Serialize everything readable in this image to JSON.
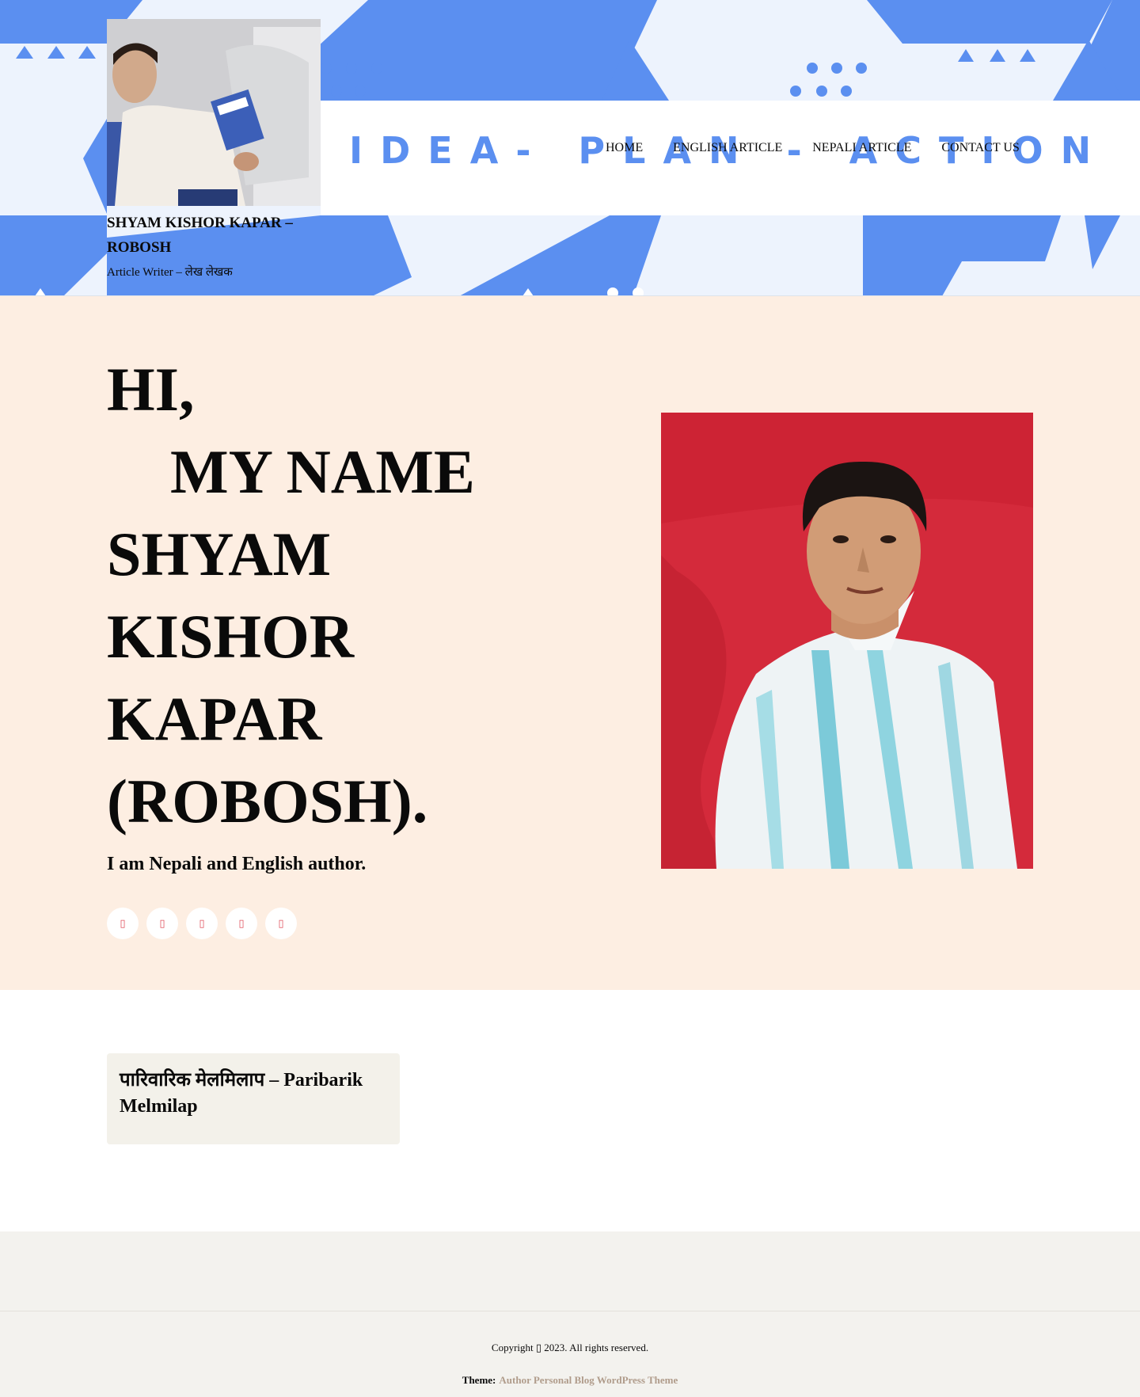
{
  "site": {
    "title": "SHYAM KISHOR KAPAR – ROBOSH",
    "tagline": "Article Writer – लेख लेखक"
  },
  "header": {
    "slogan": "IDEA- PLAN - ACTION"
  },
  "nav": {
    "items": [
      "HOME",
      "ENGLISH ARTICLE",
      "NEPALI ARTICLE",
      "CONTACT US"
    ]
  },
  "hero": {
    "heading_line1": "HI,",
    "heading_line2": "MY NAME",
    "heading_line3": "SHYAM",
    "heading_line4": "KISHOR",
    "heading_line5": "KAPAR",
    "heading_line6": "(ROBOSH).",
    "subheading": "I am Nepali and English author.",
    "social_icons": [
      "facebook-icon",
      "twitter-icon",
      "instagram-icon",
      "linkedin-icon",
      "youtube-icon"
    ],
    "social_glyph": "▯"
  },
  "posts": [
    {
      "title": "पारिवारिक मेलमिलाप – Paribarik Melmilap"
    }
  ],
  "footer": {
    "copyright": "Copyright ▯ 2023. All rights reserved.",
    "theme_label": "Theme:",
    "theme_link": "Author Personal Blog WordPress Theme"
  },
  "colors": {
    "header_pattern_blue": "#5b8ff0",
    "header_bg": "#edf3fd",
    "hero_bg": "#fdeee2",
    "social_icon": "#e0505c",
    "card_bg": "#f3f1ea",
    "footer_bg": "#f3f2ee",
    "theme_link": "#b09c8b"
  }
}
